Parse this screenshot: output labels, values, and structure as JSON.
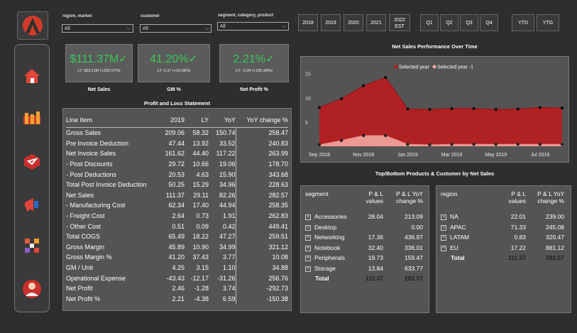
{
  "filters": [
    {
      "label": "region, market",
      "value": "All"
    },
    {
      "label": "customer",
      "value": "All"
    },
    {
      "label": "segment, category, product",
      "value": "All"
    }
  ],
  "years": [
    {
      "lines": [
        "2018"
      ]
    },
    {
      "lines": [
        "2019"
      ]
    },
    {
      "lines": [
        "2020"
      ]
    },
    {
      "lines": [
        "2021"
      ]
    },
    {
      "lines": [
        "2022",
        "EST"
      ]
    }
  ],
  "quarters": [
    "Q1",
    "Q2",
    "Q3",
    "Q4"
  ],
  "periods": [
    "YTD",
    "YTG"
  ],
  "kpis": [
    {
      "value": "$111.37M✓",
      "sub": "LY: $29.11M (+282.57%)",
      "label": "Net Sales"
    },
    {
      "value": "41.20%✓",
      "sub": "LY: 0.37 (+10.08%)",
      "label": "GM %"
    },
    {
      "value": "2.21%✓",
      "sub": "LY: -0.04 (+150.38%)",
      "label": "Net Profit %"
    }
  ],
  "pl": {
    "title": "Profit and Loss Statement",
    "headers": [
      "Line Item",
      "2019",
      "LY",
      "YoY",
      "YoY change %"
    ],
    "rows": [
      [
        "Gross Sales",
        "209.06",
        "58.32",
        "150.74",
        "258.47"
      ],
      [
        "Pre Invoice Deduction",
        "47.44",
        "13.92",
        "33.52",
        "240.83"
      ],
      [
        "Net Invoice Sales",
        "161.62",
        "44.40",
        "117.22",
        "263.99"
      ],
      [
        " - Post Discounts",
        "29.72",
        "10.66",
        "19.06",
        "178.70"
      ],
      [
        " - Post Deductions",
        "20.53",
        "4.63",
        "15.90",
        "343.68"
      ],
      [
        "Total Post Invoice Deduction",
        "50.25",
        "15.29",
        "34.96",
        "228.63"
      ],
      [
        "Net Sales",
        "111.37",
        "29.11",
        "82.26",
        "282.57"
      ],
      [
        " - Manufacturing Cost",
        "62.34",
        "17.40",
        "44.94",
        "258.35"
      ],
      [
        " - Freight Cost",
        "2.64",
        "0.73",
        "1.91",
        "262.83"
      ],
      [
        " - Other Cost",
        "0.51",
        "0.09",
        "0.42",
        "449.41"
      ],
      [
        "Total COGS",
        "65.49",
        "18.22",
        "47.27",
        "259.51"
      ],
      [
        "Gross Margin",
        "45.89",
        "10.90",
        "34.99",
        "321.12"
      ],
      [
        "Gross Margin %",
        "41.20",
        "37.43",
        "3.77",
        "10.08"
      ],
      [
        "GM / Unit",
        "4.25",
        "3.15",
        "1.10",
        "34.88"
      ],
      [
        "Operational Expense",
        "-43.43",
        "-12.17",
        "-31.26",
        "256.76"
      ],
      [
        "Net Profit",
        "2.46",
        "-1.28",
        "3.74",
        "-292.73"
      ],
      [
        "Net Profit %",
        "2.21",
        "-4.38",
        "6.59",
        "-150.38"
      ]
    ]
  },
  "chart_data": {
    "type": "area",
    "title": "Net Sales Performance Over Time",
    "x": [
      "Sep 2018",
      "Oct 2018",
      "Nov 2018",
      "Dec 2018",
      "Jan 2019",
      "Feb 2019",
      "Mar 2019",
      "Apr 2019",
      "May 2019",
      "Jun 2019",
      "Jul 2019",
      "Aug 2019"
    ],
    "x_ticks": [
      "Sep 2018",
      "Nov 2018",
      "Jan 2019",
      "Mar 2019",
      "May 2019",
      "Jul 2019"
    ],
    "y_ticks": [
      5,
      10,
      15
    ],
    "ylim": [
      0,
      17
    ],
    "series": [
      {
        "name": "Selected year",
        "color": "#c0191b",
        "values": [
          8.0,
          9.8,
          12.5,
          14.2,
          7.7,
          7.6,
          7.8,
          7.8,
          7.6,
          7.7,
          8.0,
          7.9
        ]
      },
      {
        "name": "Selected year -1",
        "color": "#f2a7a0",
        "values": [
          0.3,
          1.2,
          2.2,
          2.2,
          0.4,
          0.3,
          0.4,
          0.4,
          0.4,
          0.4,
          0.4,
          0.4
        ]
      }
    ]
  },
  "topbottom_title": "Top/Bottom Products & Customer by Net Sales",
  "segment_table": {
    "headers": [
      "segment",
      "P & L values",
      "P & L YoY change %"
    ],
    "rows": [
      [
        "Accessories",
        "28.04",
        "213.09"
      ],
      [
        "Desktop",
        "",
        "0.00"
      ],
      [
        "Networking",
        "17.36",
        "436.97"
      ],
      [
        "Notebook",
        "32.40",
        "336.01"
      ],
      [
        "Peripherals",
        "19.73",
        "159.47"
      ],
      [
        "Storage",
        "13.84",
        "633.77"
      ]
    ],
    "total": [
      "Total",
      "111.37",
      "282.57"
    ]
  },
  "region_table": {
    "headers": [
      "region",
      "P & L values",
      "P & L YoY change %"
    ],
    "rows": [
      [
        "NA",
        "22.01",
        "239.00"
      ],
      [
        "APAC",
        "71.33",
        "245.08"
      ],
      [
        "LATAM",
        "0.83",
        "320.47"
      ],
      [
        "EU",
        "17.22",
        "881.12"
      ]
    ],
    "total": [
      "Total",
      "111.37",
      "282.57"
    ]
  }
}
